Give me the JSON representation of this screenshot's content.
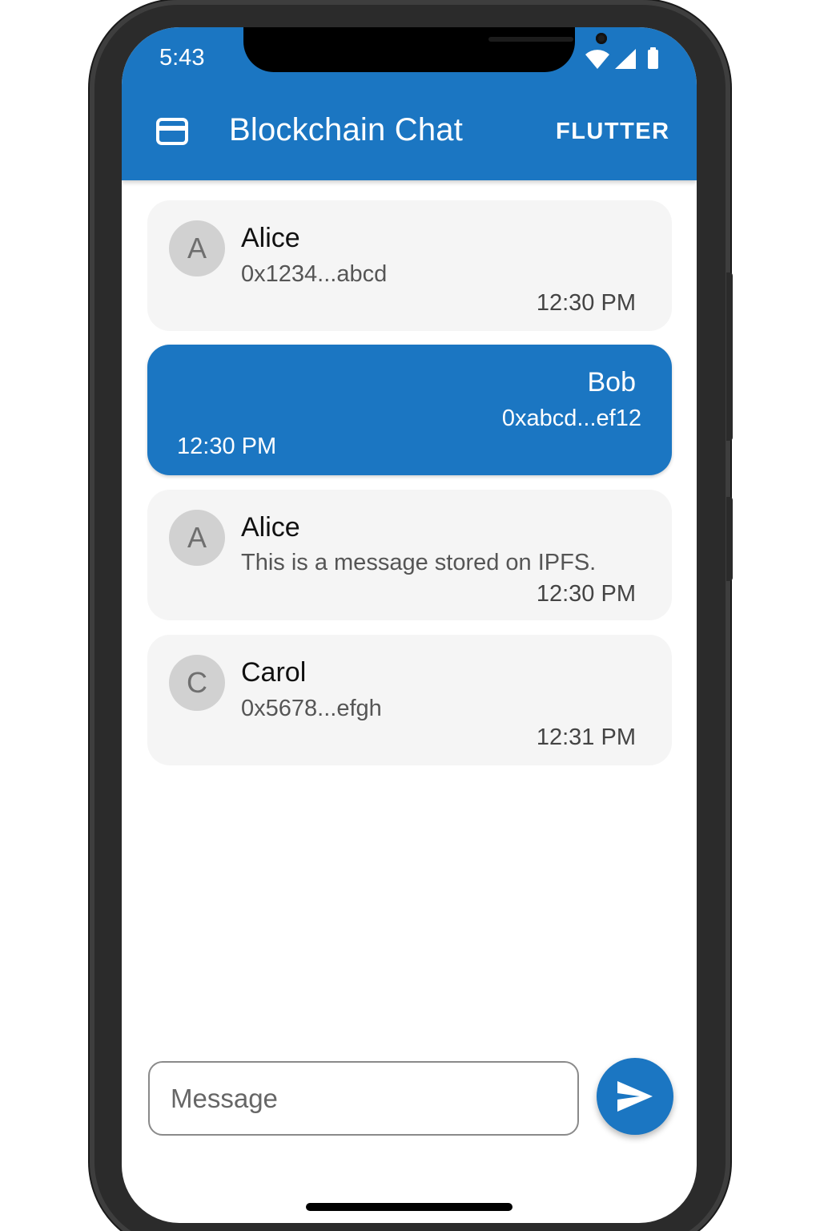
{
  "status_bar": {
    "time": "5:43",
    "icons": [
      "wifi-icon",
      "signal-icon",
      "battery-icon"
    ]
  },
  "app_bar": {
    "icon": "card-icon",
    "title": "Blockchain Chat",
    "action": "FLUTTER"
  },
  "messages": [
    {
      "avatar": "A",
      "sender": "Alice",
      "text": "0x1234...abcd",
      "time": "12:30 PM",
      "outgoing": false
    },
    {
      "sender": "Bob",
      "text": "0xabcd...ef12",
      "time": "12:30 PM",
      "outgoing": true
    },
    {
      "avatar": "A",
      "sender": "Alice",
      "text": "This is a message stored on IPFS.",
      "time": "12:30 PM",
      "outgoing": false
    },
    {
      "avatar": "C",
      "sender": "Carol",
      "text": "0x5678...efgh",
      "time": "12:31 PM",
      "outgoing": false
    }
  ],
  "composer": {
    "placeholder": "Message",
    "value": "",
    "send_icon": "send-icon"
  },
  "colors": {
    "primary": "#1b76c2",
    "bubble": "#f5f5f5",
    "avatar": "#d1d1d1"
  }
}
